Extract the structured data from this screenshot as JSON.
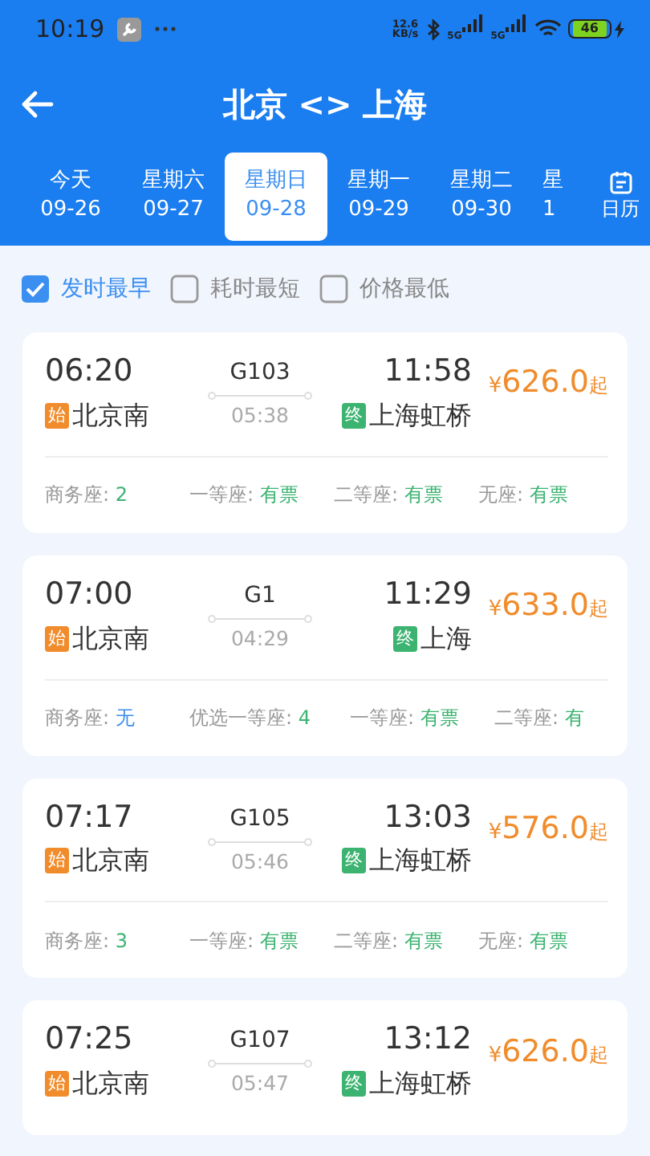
{
  "status_bar": {
    "time": "10:19",
    "speed": "12.6",
    "speed_unit": "KB/s",
    "networks": [
      "5G",
      "5G"
    ],
    "battery": "46",
    "charging": true
  },
  "header": {
    "title": "北京 <> 上海"
  },
  "dates": [
    {
      "weekday": "今天",
      "date": "09-26",
      "selected": false
    },
    {
      "weekday": "星期六",
      "date": "09-27",
      "selected": false
    },
    {
      "weekday": "星期日",
      "date": "09-28",
      "selected": true
    },
    {
      "weekday": "星期一",
      "date": "09-29",
      "selected": false
    },
    {
      "weekday": "星期二",
      "date": "09-30",
      "selected": false
    },
    {
      "weekday": "星",
      "date": "1",
      "selected": false
    }
  ],
  "calendar_button": {
    "label": "日历"
  },
  "filters": [
    {
      "label": "发时最早",
      "checked": true
    },
    {
      "label": "耗时最短",
      "checked": false
    },
    {
      "label": "价格最低",
      "checked": false
    }
  ],
  "trains": [
    {
      "depart": "06:20",
      "number": "G103",
      "arrive": "11:58",
      "from_tag": "始",
      "from": "北京南",
      "duration": "05:38",
      "to_tag": "终",
      "to": "上海虹桥",
      "currency": "¥",
      "price": "626.0",
      "suffix": "起",
      "seats": [
        {
          "label": "商务座:",
          "value": "2",
          "color": "#3cb371"
        },
        {
          "label": "一等座:",
          "value": "有票",
          "color": "#3cb371"
        },
        {
          "label": "二等座:",
          "value": "有票",
          "color": "#3cb371"
        },
        {
          "label": "无座:",
          "value": "有票",
          "color": "#3cb371"
        }
      ]
    },
    {
      "depart": "07:00",
      "number": "G1",
      "arrive": "11:29",
      "from_tag": "始",
      "from": "北京南",
      "duration": "04:29",
      "to_tag": "终",
      "to": "上海",
      "currency": "¥",
      "price": "633.0",
      "suffix": "起",
      "seats": [
        {
          "label": "商务座:",
          "value": "无",
          "color": "#3d8ee8"
        },
        {
          "label": "优选一等座:",
          "value": "4",
          "color": "#3cb371"
        },
        {
          "label": "一等座:",
          "value": "有票",
          "color": "#3cb371"
        },
        {
          "label": "二等座:",
          "value": "有",
          "color": "#3cb371"
        }
      ]
    },
    {
      "depart": "07:17",
      "number": "G105",
      "arrive": "13:03",
      "from_tag": "始",
      "from": "北京南",
      "duration": "05:46",
      "to_tag": "终",
      "to": "上海虹桥",
      "currency": "¥",
      "price": "576.0",
      "suffix": "起",
      "seats": [
        {
          "label": "商务座:",
          "value": "3",
          "color": "#3cb371"
        },
        {
          "label": "一等座:",
          "value": "有票",
          "color": "#3cb371"
        },
        {
          "label": "二等座:",
          "value": "有票",
          "color": "#3cb371"
        },
        {
          "label": "无座:",
          "value": "有票",
          "color": "#3cb371"
        }
      ]
    },
    {
      "depart": "07:25",
      "number": "G107",
      "arrive": "13:12",
      "from_tag": "始",
      "from": "北京南",
      "duration": "05:47",
      "to_tag": "终",
      "to": "上海虹桥",
      "currency": "¥",
      "price": "626.0",
      "suffix": "起"
    }
  ]
}
